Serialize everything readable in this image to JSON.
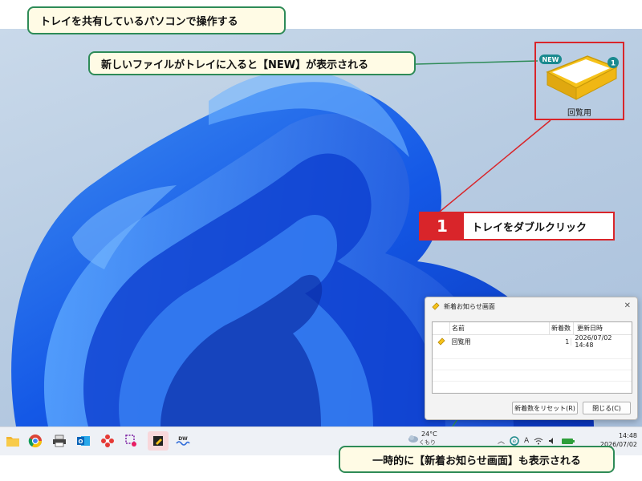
{
  "callouts": {
    "title": "トレイを共有しているパソコンで操作する",
    "new_badge_note": "新しいファイルがトレイに入ると【NEW】が表示される",
    "popup_note": "一時的に【新着お知らせ画面】も表示される"
  },
  "tray": {
    "badge_new": "NEW",
    "badge_count": "1",
    "label": "回覧用",
    "icon": "tray-icon"
  },
  "step": {
    "number": "1",
    "text": "トレイをダブルクリック"
  },
  "notify_window": {
    "title": "新着お知らせ画面",
    "close_glyph": "✕",
    "columns": {
      "name": "名前",
      "count": "新着数",
      "date": "更新日時"
    },
    "rows": [
      {
        "name": "回覧用",
        "count": "1",
        "date": "2026/07/02 14:48"
      }
    ],
    "reset_button": "新着数をリセット(R)",
    "close_button": "閉じる(C)"
  },
  "taskbar": {
    "icons": [
      "folder-icon",
      "chrome-icon",
      "printer-icon",
      "outlook-icon",
      "flower-app-icon",
      "snip-tool-icon",
      "tray-app-icon",
      "docuworks-icon"
    ],
    "docuworks_label": "DW",
    "weather": {
      "temp": "24°C",
      "desc": "くもり"
    },
    "tray_letter": "A",
    "clock": {
      "time": "14:48",
      "date": "2026/07/02"
    }
  },
  "colors": {
    "callout_border": "#2e8b57",
    "callout_bg": "#fffbe5",
    "highlight_red": "#d9252a",
    "tray_yellow": "#f6c21a",
    "badge_teal": "#1b8a8f"
  }
}
